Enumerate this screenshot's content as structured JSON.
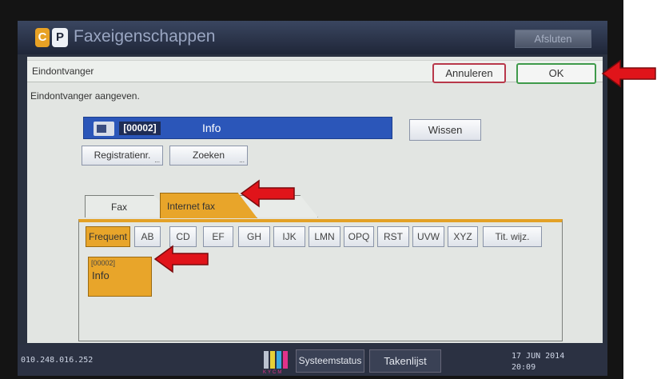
{
  "window": {
    "title": "Faxeigenschappen",
    "close_label": "Afsluten"
  },
  "header": {
    "label": "Eindontvanger",
    "cancel_label": "Annuleren",
    "ok_label": "OK"
  },
  "instruction": "Eindontvanger aangeven.",
  "recipient": {
    "code": "[00002]",
    "name": "Info",
    "clear_label": "Wissen"
  },
  "actions": {
    "register_label": "Registratienr.",
    "search_label": "Zoeken"
  },
  "tabs": [
    {
      "label": "Fax",
      "active": false
    },
    {
      "label": "Internet fax",
      "active": true
    },
    {
      "label": "",
      "active": false
    }
  ],
  "index_buttons": [
    {
      "label": "Frequent",
      "active": true
    },
    {
      "label": "AB"
    },
    {
      "label": "CD"
    },
    {
      "label": "EF"
    },
    {
      "label": "GH"
    },
    {
      "label": "IJK"
    },
    {
      "label": "LMN"
    },
    {
      "label": "OPQ"
    },
    {
      "label": "RST"
    },
    {
      "label": "UVW"
    },
    {
      "label": "XYZ"
    },
    {
      "label": "Tit. wijz."
    }
  ],
  "entries": [
    {
      "code": "[00002]",
      "name": "Info"
    }
  ],
  "status": {
    "ip": "010.248.016.252",
    "system_status_label": "Systeemstatus",
    "job_list_label": "Takenlijst",
    "date": "17 JUN  2014",
    "time": "20:09",
    "toner_letters": "KYCM"
  },
  "colors": {
    "accent": "#e8a52a",
    "selection": "#2b56b9",
    "cancel_border": "#b8384a",
    "ok_border": "#3e9a4a",
    "annotation_arrow": "#e0141a"
  },
  "icons": [
    "fax-machine-icon",
    "toner-status-icon",
    "red-arrow-annotation"
  ]
}
